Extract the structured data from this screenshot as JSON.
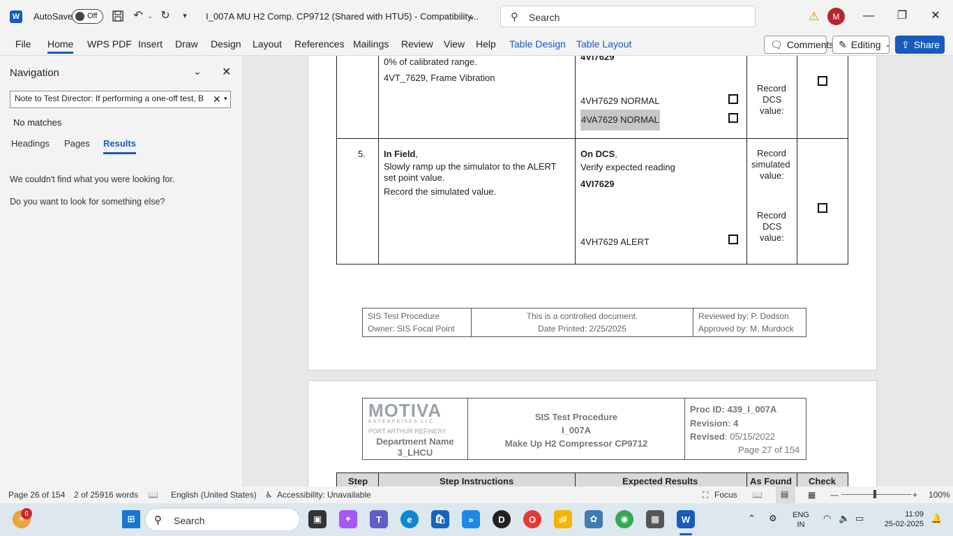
{
  "titlebar": {
    "app_icon": "word-icon",
    "autosave_label": "AutoSave",
    "autosave_state": "Off",
    "doc_title": "I_007A MU H2 Comp. CP9712 (Shared with HTU5)  -  Compatibility...",
    "search_placeholder": "Search",
    "avatar_initial": "M"
  },
  "ribbon": {
    "tabs": [
      "File",
      "Home",
      "WPS PDF",
      "Insert",
      "Draw",
      "Design",
      "Layout",
      "References",
      "Mailings",
      "Review",
      "View",
      "Help",
      "Table Design",
      "Table Layout"
    ],
    "active_tab": "Home",
    "comments_label": "Comments",
    "editing_label": "Editing",
    "share_label": "Share"
  },
  "navigation": {
    "title": "Navigation",
    "search_value": "Note to Test Director: If performing a one-off test, B",
    "no_matches": "No matches",
    "tabs": [
      "Headings",
      "Pages",
      "Results"
    ],
    "active_tab": "Results",
    "msg1": "We couldn't find what you were looking for.",
    "msg2": "Do you want to look for something else?"
  },
  "document": {
    "row4": {
      "instr_line1": "0% of calibrated range.",
      "instr_line2": "4VT_7629, Frame Vibration",
      "expected_tag": "4VI7629",
      "expected_line1": "4VH7629 NORMAL",
      "expected_line2": "4VA7629 NORMAL",
      "asfound_line1": "Record",
      "asfound_line2": "DCS",
      "asfound_line3": "value:"
    },
    "row5": {
      "step": "5.",
      "instr_bold": "In Field",
      "instr_comma": ",",
      "instr_line1": "Slowly ramp up the simulator to the ALERT",
      "instr_line2": "set point value.",
      "instr_line3": "Record the simulated value.",
      "expected_bold": "On DCS",
      "expected_comma": ",",
      "expected_line1": "Verify expected reading",
      "expected_tag": "4VI7629",
      "expected_line2": "4VH7629 ALERT",
      "asfound_a1": "Record",
      "asfound_a2": "simulated",
      "asfound_a3": "value:",
      "asfound_b1": "Record",
      "asfound_b2": "DCS",
      "asfound_b3": "value:"
    },
    "footer": {
      "left1": "SIS Test Procedure",
      "left2": "Owner: SIS Focal Point",
      "mid1": "This is a controlled document.",
      "mid2": "Date Printed: 2/25/2025",
      "right1": "Reviewed by: P. Dodson",
      "right2": "Approved by: M. Murdock"
    },
    "header": {
      "logo_text": "MOTIVA",
      "logo_sub": "ENTERPRISES LLC",
      "refinery": "PORT ARTHUR REFINERY",
      "dept1": "Department Name",
      "dept2": "3_LHCU",
      "mid1": "SIS Test Procedure",
      "mid2": "I_007A",
      "mid3": "Make Up H2 Compressor CP9712",
      "proc_id": "Proc ID: 439_I_007A",
      "revision": "Revision: 4",
      "revised_label": "Revised",
      "revised_value": ": 05/15/2022",
      "page_of": "Page 27 of 154"
    },
    "table_headers": [
      "Step",
      "Step Instructions",
      "Expected Results",
      "As Found",
      "Check"
    ]
  },
  "statusbar": {
    "page": "Page 26 of 154",
    "words": "2 of 25916 words",
    "language": "English (United States)",
    "accessibility": "Accessibility: Unavailable",
    "focus": "Focus",
    "zoom": "100%"
  },
  "taskbar": {
    "badge": "6",
    "search_placeholder": "Search",
    "lang1": "ENG",
    "lang2": "IN",
    "time": "11:09",
    "date": "25-02-2025"
  }
}
